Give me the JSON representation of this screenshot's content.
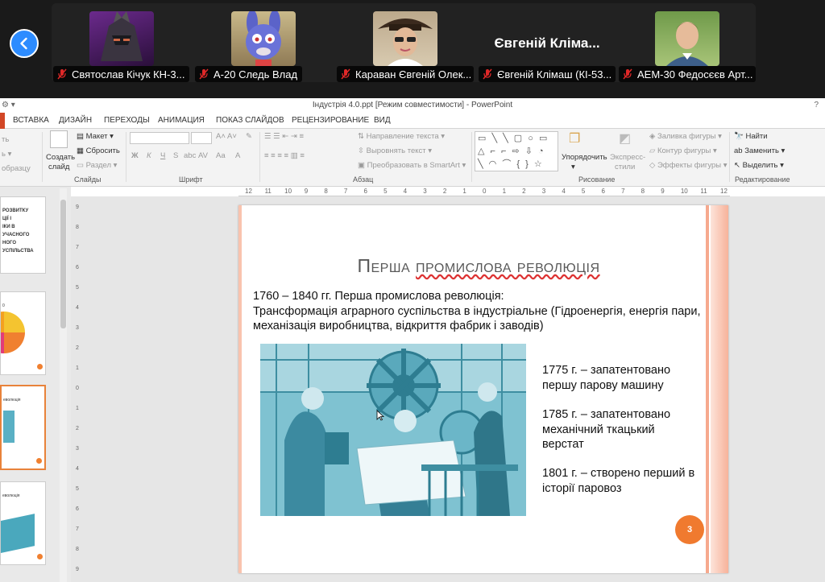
{
  "meeting": {
    "participants": [
      {
        "name": "Святослав Кічук КН-3...",
        "avatar": "robot-avatar"
      },
      {
        "name": "А-20 Следь Влад",
        "avatar": "bunny-avatar"
      },
      {
        "name": "Караван Євгеній Олек...",
        "avatar": "woman-pirate-hat-avatar"
      },
      {
        "name": "Євгеній Клімаш (КІ-53...",
        "display_name": "Євгеній Кліма...",
        "avatar": "none"
      },
      {
        "name": "АЕМ-30 Федосєєв Арт...",
        "avatar": "man-photo-avatar"
      }
    ]
  },
  "window": {
    "title": "Індустрія 4.0.ppt [Режим совместимости] - PowerPoint",
    "help": "?"
  },
  "ribbon": {
    "tabs": [
      "ВСТАВКА",
      "ДИЗАЙН",
      "ПЕРЕХОДЫ",
      "АНИМАЦИЯ",
      "ПОКАЗ СЛАЙДОВ",
      "РЕЦЕНЗИРОВАНИЕ",
      "ВИД"
    ],
    "slides": {
      "new_slide": "Создать",
      "new_slide2": "слайд",
      "layout": "Макет",
      "reset": "Сбросить",
      "section": "Раздел",
      "label": "Слайды"
    },
    "clipboard": {
      "cut": "ть",
      "format": "образцу"
    },
    "font": {
      "bold": "Ж",
      "italic": "К",
      "underline": "Ч",
      "strike": "S",
      "shadow": "abc",
      "spacing": "AV",
      "case": "Aa",
      "color": "A",
      "label": "Шрифт"
    },
    "paragraph": {
      "direction": "Направление текста",
      "align": "Выровнять текст",
      "smartart": "Преобразовать в SmartArt",
      "label": "Абзац"
    },
    "drawing": {
      "arrange": "Упорядочить",
      "styles": "Экспресс-",
      "styles2": "стили",
      "fill": "Заливка фигуры",
      "outline": "Контур фигуры",
      "effects": "Эффекты фигуры",
      "label": "Рисование"
    },
    "editing": {
      "find": "Найти",
      "replace": "Заменить",
      "select": "Выделить",
      "label": "Редактирование"
    }
  },
  "ruler_top": [
    "12",
    "11",
    "10",
    "9",
    "8",
    "7",
    "6",
    "5",
    "4",
    "3",
    "2",
    "1",
    "0",
    "1",
    "2",
    "3",
    "4",
    "5",
    "6",
    "7",
    "8",
    "9",
    "10",
    "11",
    "12"
  ],
  "ruler_left": [
    "9",
    "8",
    "7",
    "6",
    "5",
    "4",
    "3",
    "2",
    "1",
    "0",
    "1",
    "2",
    "3",
    "4",
    "5",
    "6",
    "7",
    "8",
    "9"
  ],
  "thumbnails": [
    {
      "lines": [
        "РОЗВИТКУ",
        "ЦІЇ І",
        "ІКИ В",
        "УЧАСНОГО",
        "НОГО",
        "УСПІЛЬСТВА"
      ]
    },
    {
      "lines": [
        "0"
      ]
    },
    {
      "lines": [
        "еволюція"
      ]
    },
    {
      "lines": [
        "еволюція"
      ]
    }
  ],
  "slide": {
    "title_part1": "Перша ",
    "title_part2": "промислова революція",
    "body_line1": "1760 – 1840 гг. Перша промислова революція:",
    "body_line2": "Трансформація аграрного суспільства в індустріальне (Гідроенергія, енергія пари, механізація виробництва, відкриття фабрик і заводів)",
    "facts": [
      "1775 г. – запатентовано першу парову машину",
      "1785 г. – запатентовано механічний ткацький верстат",
      "1801 г. – створено перший в історії паровоз"
    ],
    "page_number": "3"
  },
  "colors": {
    "accent": "#f07a2f",
    "zoom_blue": "#2d8cff",
    "mute_red": "#e02828",
    "illustration": "#4aa8bd"
  }
}
